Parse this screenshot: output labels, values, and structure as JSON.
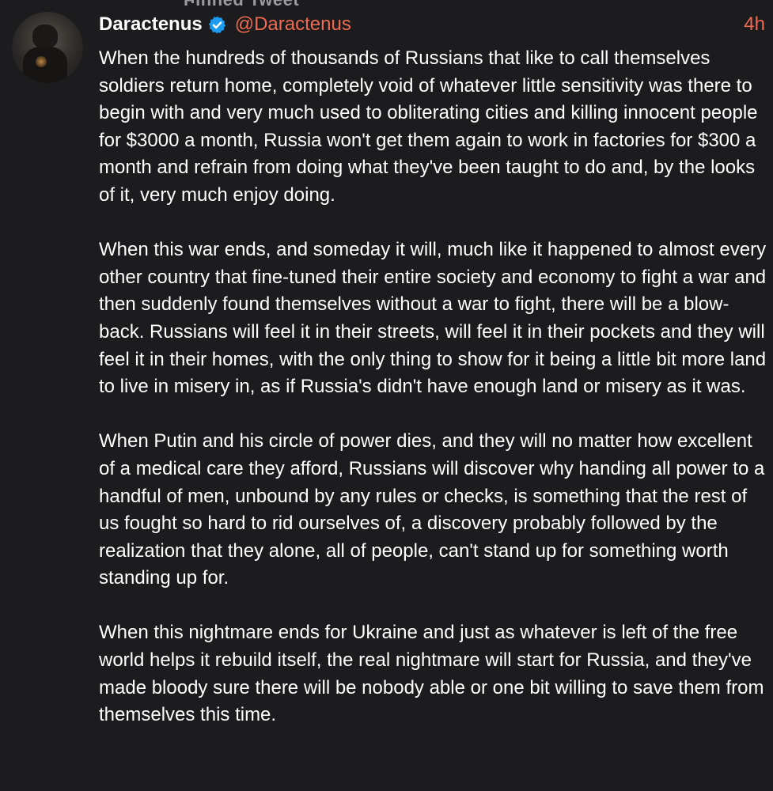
{
  "header": {
    "pinned_label": "Pinned Tweet"
  },
  "post": {
    "display_name": "Daractenus",
    "handle": "@Daractenus",
    "timestamp": "4h",
    "verified": true,
    "paragraphs": [
      "When the hundreds of thousands of Russians that like to call themselves soldiers return home, completely void of whatever little sensitivity was there to begin with and very much used to obliterating cities and killing innocent people for $3000 a month, Russia won't get them again to work in factories for $300 a month and refrain from doing what they've been taught to do and, by the looks of it, very much enjoy doing.",
      "When this war ends, and someday it will, much like it happened to almost every other country that fine-tuned their entire society and economy to fight a war and then suddenly found themselves without a war to fight, there will be a blow-back. Russians will feel it in their streets, will feel it in their pockets and they will feel it in their homes, with the only thing to show for it being a little bit more land to live in misery in, as if Russia's didn't have enough land or misery as it was.",
      "When Putin and his circle of power dies, and they will no matter how excellent of a medical care they afford, Russians will discover why handing all power to a handful of men, unbound by any rules or checks, is something that the rest of us fought so hard to rid ourselves of, a discovery probably followed by the realization that they alone, all of people, can't stand up for something worth standing up for.",
      "When this nightmare ends for Ukraine and just as whatever is left of the free world helps it rebuild itself, the real nightmare will start for Russia, and they've made bloody sure there will be nobody able or one bit willing to save them from themselves this time."
    ]
  },
  "icons": {
    "verified": "verified-badge-icon",
    "avatar": "profile-avatar"
  },
  "colors": {
    "background": "#1c1c1e",
    "text": "#ffffff",
    "accent": "#ee6b51",
    "verified_badge": "#1d9bf0",
    "muted": "#9a9a9f"
  }
}
